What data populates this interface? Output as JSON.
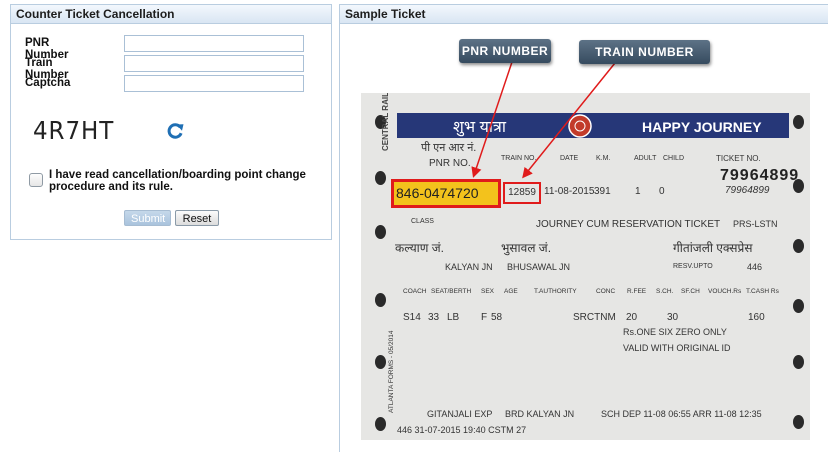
{
  "left_panel": {
    "title": "Counter Ticket Cancellation",
    "fields": [
      {
        "label": "PNR Number",
        "value": "",
        "placeholder": ""
      },
      {
        "label": "Train Number",
        "value": "",
        "placeholder": ""
      },
      {
        "label": "Captcha",
        "value": "",
        "placeholder": ""
      }
    ],
    "captcha_text": "4R7HT",
    "refresh_icon": "refresh-icon",
    "agree_text": "I have read cancellation/boarding point change procedure and its rule.",
    "submit_label": "Submit",
    "reset_label": "Reset"
  },
  "right_panel": {
    "title": "Sample Ticket",
    "pnr_tag": "PNR NUMBER",
    "train_tag": "TRAIN NUMBER",
    "ticket": {
      "header_hindi": "शुभ यात्रा",
      "header_english": "HAPPY JOURNEY",
      "col_ticket_no": "TICKET NO.",
      "col_pnr_hindi": "पी एन आर नं.",
      "col_pnr": "PNR NO.",
      "col_train": "TRAIN NO.",
      "col_date": "DATE",
      "col_km": "K.M.",
      "col_adult": "ADULT",
      "col_child": "CHILD",
      "pnr_value": "846-0474720",
      "train_value": "12859",
      "date_value": "11-08-2015",
      "km_value": "391",
      "adult_value": "1",
      "child_value": "0",
      "ticket_number": "79964899",
      "ticket_number_small": "79964899",
      "class_label": "CLASS",
      "journey_line": "JOURNEY CUM RESERVATION TICKET",
      "prs_label": "PRS-LSTN",
      "from_hindi": "कल्याण जं.",
      "to_hindi": "भुसावल जं.",
      "dest_hindi": "गीतांजली एक्सप्रेस",
      "from_station": "KALYAN JN",
      "to_station": "BHUSAWAL JN",
      "resv_upto": "RESV.UPTO",
      "resv_value": "446",
      "detail_headers": [
        "COACH",
        "SEAT/BERTH",
        "SEX",
        "AGE",
        "T.AUTHORITY",
        "CONC",
        "R.FEE",
        "S.CH.",
        "SF.CH",
        "VOUCH.Rs",
        "T.CASH Rs"
      ],
      "passenger_line": [
        "S14",
        "33",
        "LB",
        "F",
        "58",
        "SRCTNM",
        "20",
        "30",
        "160"
      ],
      "words_line1": "Rs.ONE SIX ZERO ONLY",
      "words_line2": "VALID WITH ORIGINAL ID",
      "train_name": "GITANJALI EXP",
      "brd_line": "BRD KALYAN JN",
      "sch_line": "SCH DEP 11-08 06:55 ARR 11-08 12:35",
      "footer_line": "446 31-07-2015 19:40 CSTM 27",
      "side_text": "CENTRAL RAILWAY",
      "form_text": "ATLANTA FORMS - 05/2014"
    }
  },
  "colors": {
    "panel_border": "#b9cde0",
    "ticket_header": "#263778",
    "highlight_red": "#e01b1b",
    "pnr_fill": "#f3c21c",
    "refresh_blue": "#1f6fb4"
  }
}
